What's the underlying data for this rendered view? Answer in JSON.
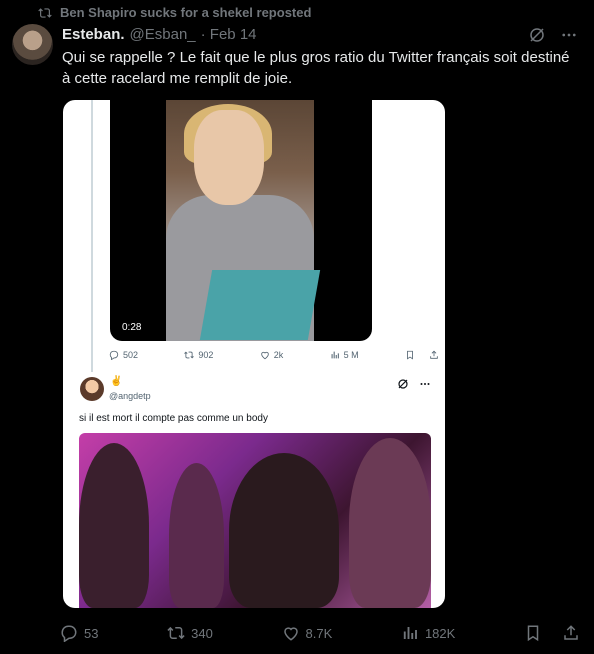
{
  "repost": {
    "text": "Ben Shapiro sucks for a shekel reposted"
  },
  "tweet": {
    "name": "Esteban.",
    "handle": "@Esban_",
    "date": "· Feb 14",
    "text": "Qui se rappelle ? Le fait que le plus gros ratio du Twitter français soit destiné à cette racelard me remplit de joie."
  },
  "embedded_video": {
    "duration": "0:28",
    "replies": "502",
    "reposts": "902",
    "likes": "2k",
    "views": "5 M"
  },
  "quoted": {
    "emoji": "✌",
    "handle": "@angdetp",
    "text": "si il est mort il compte pas comme un body"
  },
  "actions": {
    "replies": "53",
    "reposts": "340",
    "likes": "8.7K",
    "views": "182K"
  }
}
